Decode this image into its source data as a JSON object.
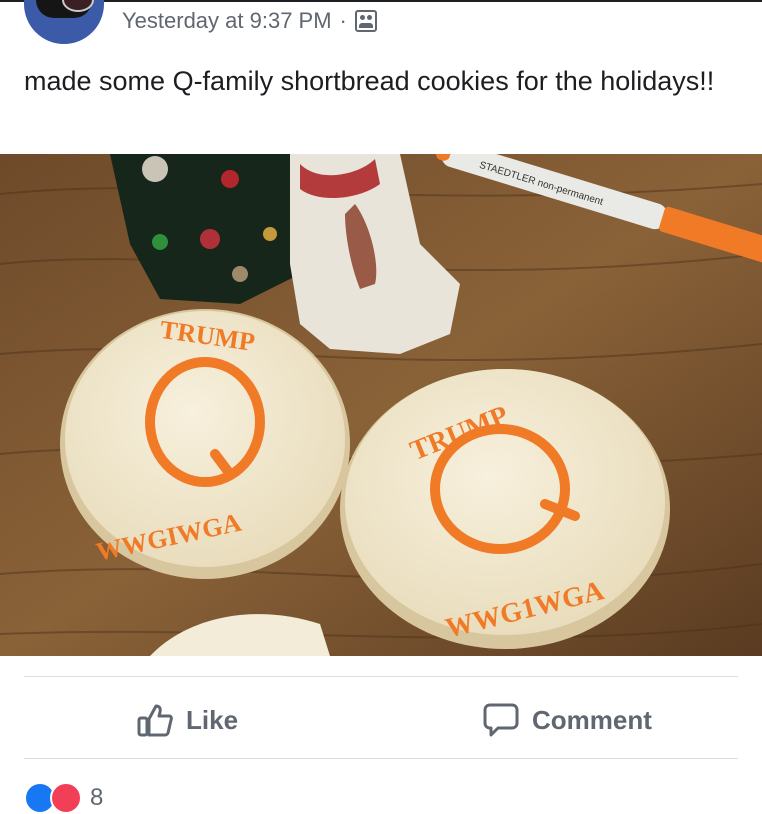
{
  "post": {
    "timestamp": "Yesterday at 9:37 PM",
    "separator": "·",
    "audience_icon": "friends-icon",
    "caption": "made some Q-family shortbread cookies for the holidays!!"
  },
  "photo": {
    "cookie1": {
      "top": "TRUMP",
      "center": "Q",
      "bottom": "WWGIWGA"
    },
    "cookie2": {
      "top": "TRUMP",
      "center": "Q",
      "bottom": "WWG1WGA"
    },
    "marker_text": "STAEDTLER non-permanent"
  },
  "actions": {
    "like_label": "Like",
    "comment_label": "Comment"
  },
  "reactions": {
    "count": "8"
  },
  "colors": {
    "accent": "#1877f2",
    "love": "#f33e58",
    "text_secondary": "#606770",
    "marker_orange": "#f07a26"
  }
}
